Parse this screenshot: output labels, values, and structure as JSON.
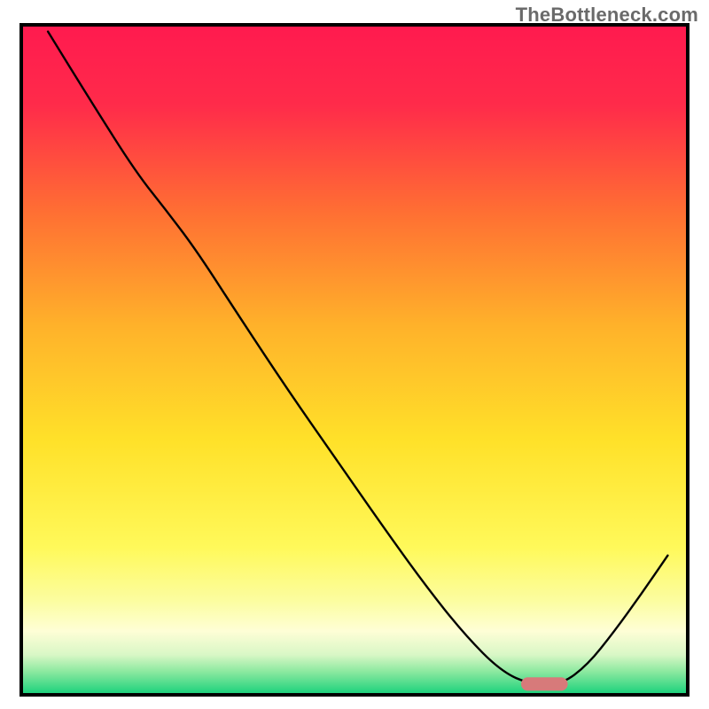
{
  "watermark": "TheBottleneck.com",
  "chart_data": {
    "type": "line",
    "title": "",
    "xlabel": "",
    "ylabel": "",
    "xlim": [
      0,
      100
    ],
    "ylim": [
      0,
      100
    ],
    "grid": false,
    "background_gradient": {
      "stops": [
        {
          "offset": 0.0,
          "color": "#ff1a4f"
        },
        {
          "offset": 0.12,
          "color": "#ff2b4a"
        },
        {
          "offset": 0.28,
          "color": "#ff6f33"
        },
        {
          "offset": 0.45,
          "color": "#ffb22a"
        },
        {
          "offset": 0.62,
          "color": "#ffe129"
        },
        {
          "offset": 0.78,
          "color": "#fff95a"
        },
        {
          "offset": 0.86,
          "color": "#fcfda0"
        },
        {
          "offset": 0.905,
          "color": "#fefed6"
        },
        {
          "offset": 0.94,
          "color": "#d9f7c6"
        },
        {
          "offset": 0.965,
          "color": "#8de9a0"
        },
        {
          "offset": 1.0,
          "color": "#16d07a"
        }
      ]
    },
    "series": [
      {
        "name": "bottleneck-curve",
        "color": "#000000",
        "width": 2.4,
        "points": [
          {
            "x": 4.0,
            "y": 99.0
          },
          {
            "x": 10.5,
            "y": 88.5
          },
          {
            "x": 17.2,
            "y": 78.0
          },
          {
            "x": 22.0,
            "y": 72.0
          },
          {
            "x": 26.5,
            "y": 66.0
          },
          {
            "x": 33.0,
            "y": 56.0
          },
          {
            "x": 40.0,
            "y": 45.5
          },
          {
            "x": 47.0,
            "y": 35.5
          },
          {
            "x": 54.0,
            "y": 25.5
          },
          {
            "x": 60.5,
            "y": 16.5
          },
          {
            "x": 66.5,
            "y": 9.0
          },
          {
            "x": 72.0,
            "y": 3.5
          },
          {
            "x": 76.5,
            "y": 1.5
          },
          {
            "x": 81.0,
            "y": 1.5
          },
          {
            "x": 85.0,
            "y": 4.5
          },
          {
            "x": 89.0,
            "y": 9.5
          },
          {
            "x": 93.0,
            "y": 15.0
          },
          {
            "x": 97.0,
            "y": 20.8
          }
        ]
      }
    ],
    "marker": {
      "name": "optimal-band",
      "shape": "rounded-rect",
      "fill": "#d77a7a",
      "x_center": 78.5,
      "y_center": 1.6,
      "width_pct": 7.0,
      "height_pct": 2.0
    },
    "border": {
      "color": "#000000",
      "width": 4
    }
  }
}
